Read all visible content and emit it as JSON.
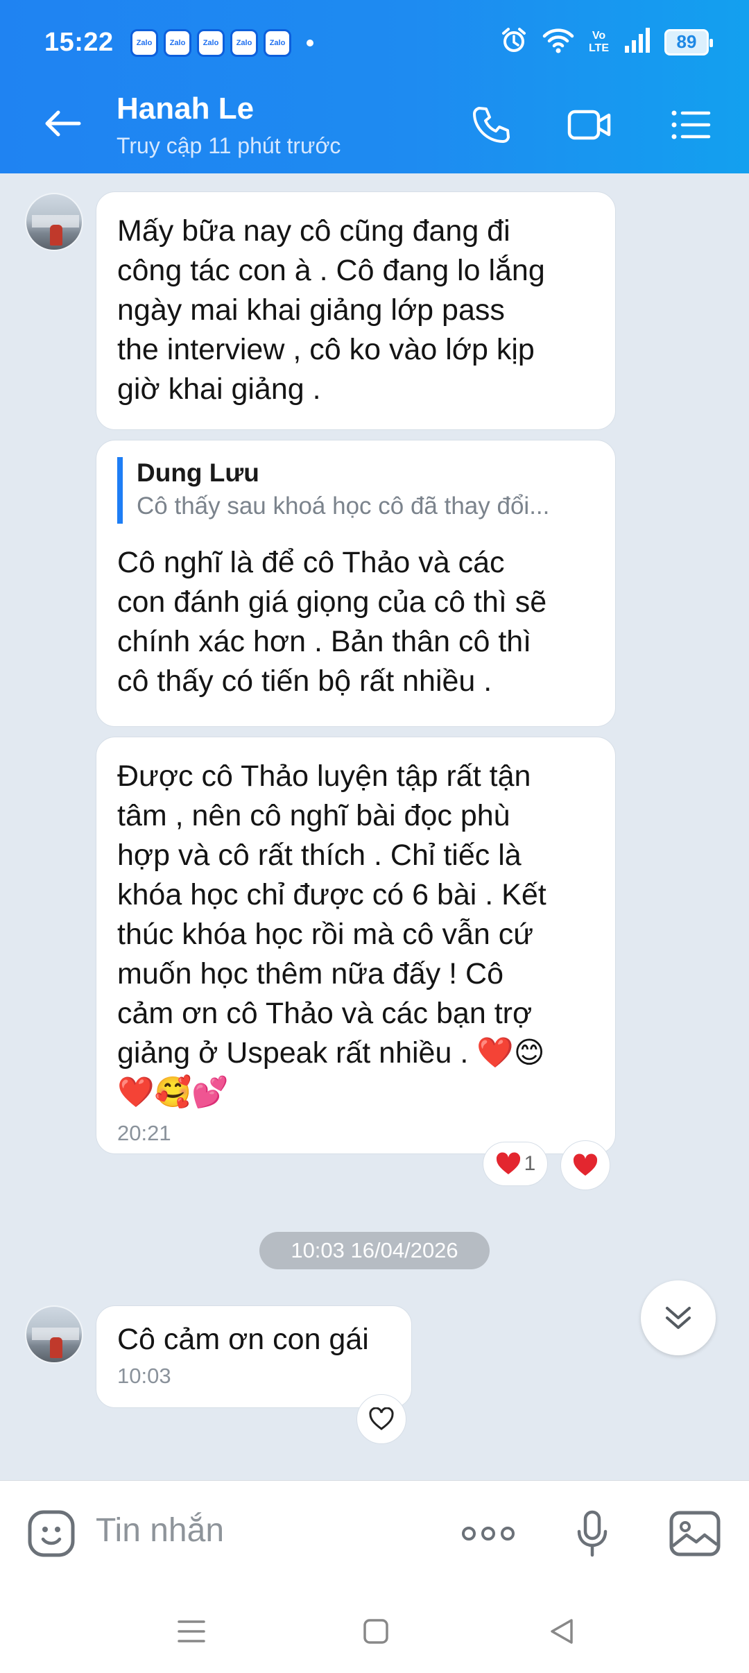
{
  "status_bar": {
    "time": "15:22",
    "app_badges": [
      "Zalo",
      "Zalo",
      "Zalo",
      "Zalo",
      "Zalo"
    ],
    "network": "Vo LTE",
    "network_line1": "Vo",
    "network_line2": "LTE",
    "battery": "89"
  },
  "header": {
    "contact_name": "Hanah Le",
    "contact_status": "Truy cập 11 phút trước",
    "icons": [
      "back-arrow-icon",
      "phone-icon",
      "video-call-icon",
      "menu-list-icon"
    ]
  },
  "messages": [
    {
      "text": "Mấy bữa nay cô cũng đang đi\ncông tác con à . Cô đang lo lắng\nngày mai khai giảng lớp pass\nthe interview , cô ko  vào lớp kịp\ngiờ khai giảng ."
    },
    {
      "quote_author": "Dung Lưu",
      "quote_text": "Cô thấy sau khoá học cô đã thay đổi...",
      "text": "Cô nghĩ là để cô Thảo và các\ncon đánh giá giọng của cô thì sẽ\nchính xác hơn . Bản thân cô thì\ncô thấy có tiến bộ rất nhiều ."
    },
    {
      "text": "Được cô Thảo luyện tập rất tận\ntâm , nên cô nghĩ bài đọc phù\nhợp và cô rất thích . Chỉ tiếc là\nkhóa học chỉ được có 6 bài . Kết\nthúc khóa học rồi mà cô vẫn cứ\nmuốn học thêm nữa đấy ! Cô\ncảm ơn cô Thảo và các bạn trợ\ngiảng ở Uspeak rất nhiều .",
      "emoji_line1": "❤️😊",
      "emoji_line2": "❤️🥰💕",
      "time": "20:21",
      "reaction_count": "1"
    },
    {
      "text": "Cô cảm ơn con gái",
      "time": "10:03"
    }
  ],
  "date_separator": "10:03 16/04/2026",
  "composer": {
    "placeholder": "Tin nhắn",
    "more_label": "ooo"
  },
  "colors": {
    "header_blue": "#1f83f2",
    "quote_bar": "#1e7ef5",
    "heart_red": "#e3262f",
    "background": "#e2e9f1"
  }
}
